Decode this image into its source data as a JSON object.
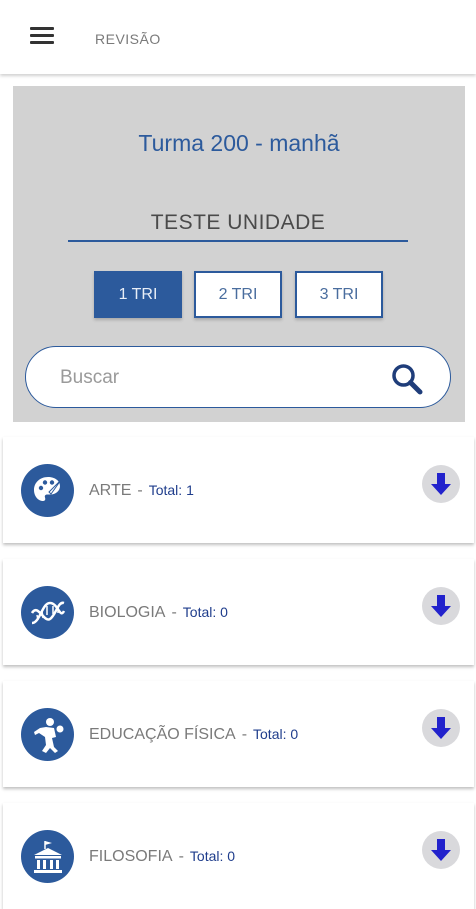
{
  "appbar": {
    "title": "REVISÃO"
  },
  "class_name": "Turma 200 - manhã",
  "test_name": "TESTE UNIDADE",
  "trimesters": [
    {
      "label": "1 TRI",
      "active": true
    },
    {
      "label": "2 TRI",
      "active": false
    },
    {
      "label": "3 TRI",
      "active": false
    }
  ],
  "search": {
    "placeholder": "Buscar",
    "value": ""
  },
  "subjects": [
    {
      "name": "ARTE",
      "separator": "-",
      "total": "Total: 1",
      "icon": "palette-icon"
    },
    {
      "name": "BIOLOGIA",
      "separator": "-",
      "total": "Total: 0",
      "icon": "dna-icon"
    },
    {
      "name": "EDUCAÇÃO FÍSICA",
      "separator": "-",
      "total": "Total: 0",
      "icon": "discus-thrower-icon"
    },
    {
      "name": "FILOSOFIA",
      "separator": "-",
      "total": "Total: 0",
      "icon": "temple-icon"
    }
  ],
  "colors": {
    "primary": "#2c5a9c",
    "panel_bg": "#d2d2d2",
    "download_arrow": "#2222cc"
  }
}
